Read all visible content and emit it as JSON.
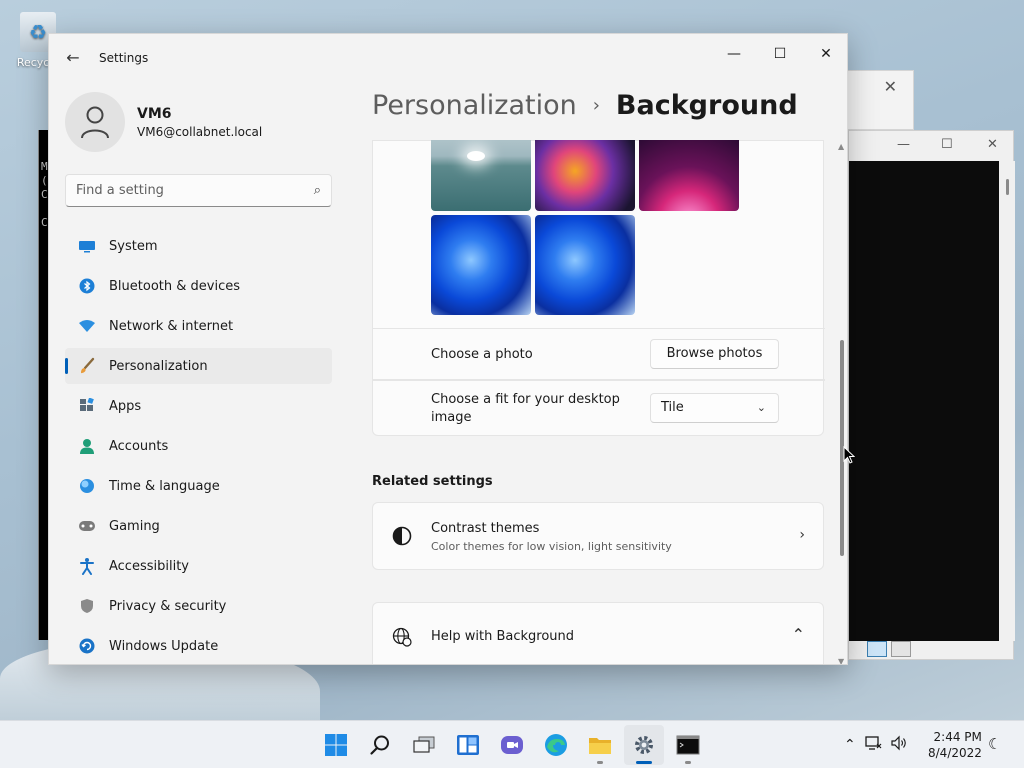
{
  "desktop": {
    "recycle_label": "Recycle",
    "console_lines": [
      "M",
      "(",
      "",
      "C",
      "",
      "C"
    ]
  },
  "settings": {
    "app_title": "Settings",
    "window_controls": {
      "minimize": "—",
      "maximize": "☐",
      "close": "✕"
    },
    "profile": {
      "name": "VM6",
      "email": "VM6@collabnet.local"
    },
    "search": {
      "placeholder": "Find a setting"
    },
    "nav": [
      {
        "label": "System",
        "icon": "monitor-icon",
        "color": "#0f6cbd"
      },
      {
        "label": "Bluetooth & devices",
        "icon": "bluetooth-icon",
        "color": "#0f6cbd"
      },
      {
        "label": "Network & internet",
        "icon": "wifi-icon",
        "color": "#2b88d8"
      },
      {
        "label": "Personalization",
        "icon": "brush-icon",
        "color": "#d08b3a",
        "active": true
      },
      {
        "label": "Apps",
        "icon": "apps-icon",
        "color": "#5a6b7a"
      },
      {
        "label": "Accounts",
        "icon": "person-icon",
        "color": "#1f9e78"
      },
      {
        "label": "Time & language",
        "icon": "globe-clock-icon",
        "color": "#2b88d8"
      },
      {
        "label": "Gaming",
        "icon": "gamepad-icon",
        "color": "#6b6b6b"
      },
      {
        "label": "Accessibility",
        "icon": "accessibility-icon",
        "color": "#1a73c7"
      },
      {
        "label": "Privacy & security",
        "icon": "shield-icon",
        "color": "#7a7a7a"
      },
      {
        "label": "Windows Update",
        "icon": "update-icon",
        "color": "#1a73c7"
      }
    ],
    "breadcrumb": {
      "parent": "Personalization",
      "separator": "›",
      "current": "Background"
    },
    "photo_row": {
      "label": "Choose a photo",
      "button": "Browse photos"
    },
    "fit_row": {
      "label": "Choose a fit for your desktop image",
      "value": "Tile"
    },
    "related": {
      "title": "Related settings",
      "contrast_title": "Contrast themes",
      "contrast_sub": "Color themes for low vision, light sensitivity"
    },
    "help": {
      "title": "Help with Background"
    }
  },
  "taskbar": {
    "clock_time": "2:44 PM",
    "clock_date": "8/4/2022"
  }
}
